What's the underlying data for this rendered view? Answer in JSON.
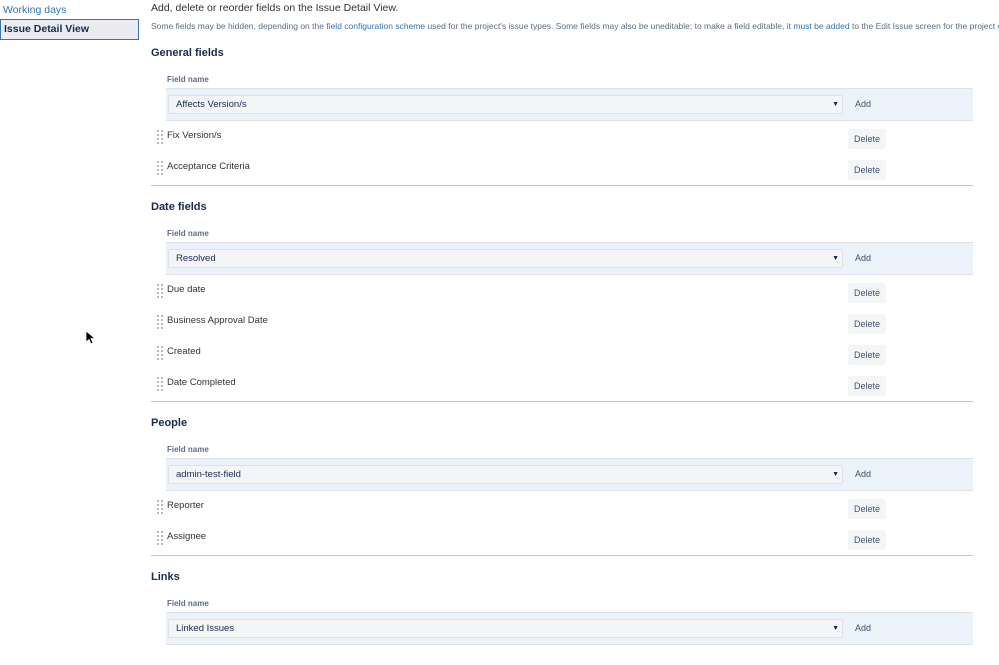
{
  "sidebar": {
    "items": [
      {
        "label": "Working days"
      },
      {
        "label": "Issue Detail View"
      }
    ]
  },
  "intro": "Add, delete or reorder fields on the Issue Detail View.",
  "description": {
    "part1": "Some fields may be hidden, depending on the ",
    "link1": "field configuration scheme",
    "part2": " used for the project's issue types. Some fields may also be uneditable; to make a field editable, ",
    "link2": "it must be added",
    "part3": " to the Edit Issue screen for the project of an issue."
  },
  "column_header": "Field name",
  "add_label": "Add",
  "delete_label": "Delete",
  "sections": [
    {
      "title": "General fields",
      "selected": "Affects Version/s",
      "fields": [
        "Fix Version/s",
        "Acceptance Criteria"
      ]
    },
    {
      "title": "Date fields",
      "selected": "Resolved",
      "fields": [
        "Due date",
        "Business Approval Date",
        "Created",
        "Date Completed"
      ]
    },
    {
      "title": "People",
      "selected": "admin-test-field",
      "fields": [
        "Reporter",
        "Assignee"
      ]
    },
    {
      "title": "Links",
      "selected": "Linked Issues",
      "fields": []
    }
  ]
}
